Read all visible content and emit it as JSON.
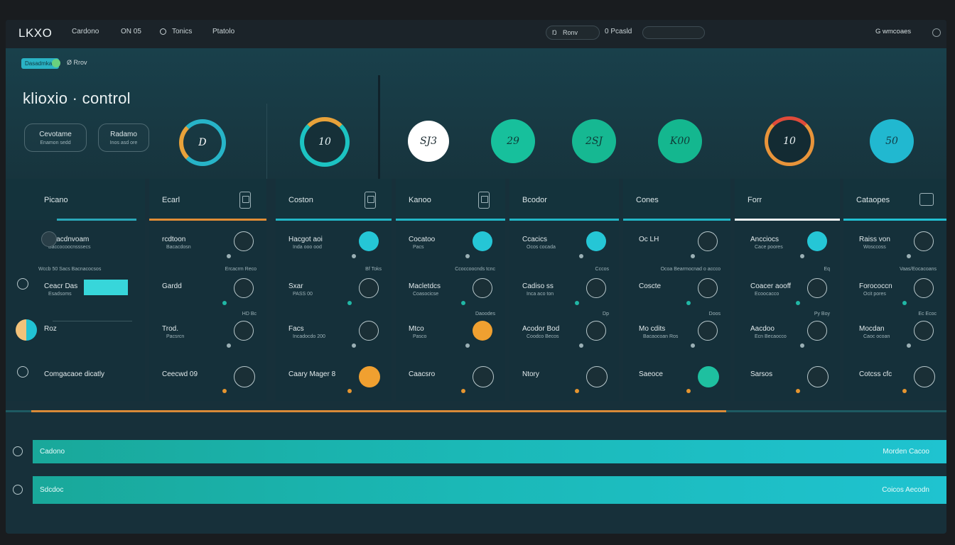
{
  "app": {
    "logo": "LKXO"
  },
  "menu": [
    "Cardono",
    "ON 05",
    "Tonics",
    "Ptatolo"
  ],
  "search": {
    "left_label": "Ŋ",
    "text": "Ronv"
  },
  "toggle": {
    "label": "0 Pcasld"
  },
  "account": {
    "label": "G wmcoaes"
  },
  "hero": {
    "badge": "Dasadmkan",
    "badge_extra": "Ø Rrov",
    "title": "klioxio · control",
    "buttons": [
      {
        "label": "Cevotame",
        "sub": "Enamon sedd"
      },
      {
        "label": "Radamo",
        "sub": "Inos asd ore"
      }
    ],
    "gauges": [
      "D",
      "10",
      "SJ3",
      "29",
      "2SJ",
      "K00",
      "10",
      "50"
    ]
  },
  "colors": {
    "accent": "#1fc3d0",
    "green": "#17b896",
    "orange": "#e89a3a",
    "bg": "#17303a"
  },
  "panels": [
    {
      "title": "Picano",
      "rows": [
        {
          "label": "Bacacdnvoam",
          "sub": "Baccocoocnsssecs"
        },
        {
          "label": "Ceacr Das",
          "sub": "Esadsoms"
        },
        {
          "label": "Roz",
          "sub": ""
        },
        {
          "label": "Comgacaoe dicatly",
          "sub": ""
        }
      ],
      "footnote": "Wccb 50 Sacs Bacnacocsos"
    },
    {
      "title": "Ecarl",
      "rows": [
        {
          "label": "rcdtoon",
          "sub": "Bacacdosn"
        },
        {
          "label": "Gardd",
          "sub": ""
        },
        {
          "label": "Trod.",
          "sub": "Pacsrcn"
        },
        {
          "label": "Ceecwd 09",
          "sub": ""
        }
      ],
      "footnote": "Ercacrm Reco",
      "extra": "HD Bc"
    },
    {
      "title": "Coston",
      "rows": [
        {
          "label": "Hacgot aoi",
          "sub": "Inda ooo ood"
        },
        {
          "label": "Sxar",
          "sub": "PASS 00"
        },
        {
          "label": "Facs",
          "sub": "Incadocdo 200"
        },
        {
          "label": "Caary Mager 8",
          "sub": ""
        }
      ],
      "footnote": "Bf Toks"
    },
    {
      "title": "Kanoo",
      "rows": [
        {
          "label": "Cocatoo",
          "sub": "Pacs"
        },
        {
          "label": "Macletdcs",
          "sub": "Coasocicse"
        },
        {
          "label": "Mtco",
          "sub": "Pasco"
        },
        {
          "label": "Caacsro",
          "sub": ""
        }
      ],
      "footnote": "Ccoccoocnds tcnc",
      "extra": "Daoodes"
    },
    {
      "title": "Bcodor",
      "rows": [
        {
          "label": "Ccacics",
          "sub": "Ocos cocada"
        },
        {
          "label": "Cadiso ss",
          "sub": "Inca aco ton"
        },
        {
          "label": "Acodor Bod",
          "sub": "Coodco Becos"
        },
        {
          "label": "Ntory",
          "sub": ""
        }
      ],
      "footnote": "Cccos",
      "extra": "Dp"
    },
    {
      "title": "Cones",
      "rows": [
        {
          "label": "Oc LH",
          "sub": ""
        },
        {
          "label": "Coscte",
          "sub": ""
        },
        {
          "label": "Mo cdits",
          "sub": "Bacaocoan Ros"
        },
        {
          "label": "Saeoce",
          "sub": ""
        }
      ],
      "footnote": "Ocoa Bearmocnad o accco",
      "extra": "Doos"
    },
    {
      "title": "Forr",
      "rows": [
        {
          "label": "Ancciocs",
          "sub": "Cace poores"
        },
        {
          "label": "Coacer aooff",
          "sub": "Ecoocacco"
        },
        {
          "label": "Aacdoo",
          "sub": "Ecn Becaocco"
        },
        {
          "label": "Sarsos",
          "sub": ""
        }
      ],
      "footnote": "Eq",
      "extra": "Py Boy"
    },
    {
      "title": "Cataopes",
      "rows": [
        {
          "label": "Raiss von",
          "sub": "Wosccoss"
        },
        {
          "label": "Forococcn",
          "sub": "Ocit pores"
        },
        {
          "label": "Mocdan",
          "sub": "Caoc ocoan"
        },
        {
          "label": "Cotcss cfc",
          "sub": ""
        }
      ],
      "footnote": "Vaas/Eocacoans",
      "extra": "Ec Ecoc"
    }
  ],
  "progress": {
    "value": 0.76
  },
  "bars": [
    {
      "left": "Cadono",
      "right": "Morden Cacoo"
    },
    {
      "left": "Sdcdoc",
      "right": "Coicos Aecodn"
    }
  ]
}
